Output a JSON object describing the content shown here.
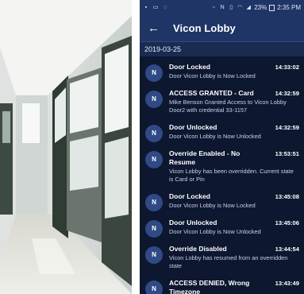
{
  "status_bar": {
    "battery": "23%",
    "time": "2:35 PM"
  },
  "app_bar": {
    "back_icon": "arrow-left-icon",
    "title": "Vicon Lobby"
  },
  "date_header": "2019-03-25",
  "events": [
    {
      "avatar": "N",
      "title": "Door Locked",
      "time": "14:33:02",
      "description": "Door Vicon Lobby is Now Locked"
    },
    {
      "avatar": "N",
      "title": "ACCESS GRANTED - Card",
      "time": "14:32:59",
      "description": "Mike Benson Granted Access to Vicon Lobby Door2 with credential 33-1157"
    },
    {
      "avatar": "N",
      "title": "Door Unlocked",
      "time": "14:32:59",
      "description": "Door Vicon Lobby is Now Unlocked"
    },
    {
      "avatar": "N",
      "title": "Override Enabled - No Resume",
      "time": "13:53:51",
      "description": "Vicon Lobby has been overridden. Current state is Card or Pin"
    },
    {
      "avatar": "N",
      "title": "Door Locked",
      "time": "13:45:08",
      "description": "Door Vicon Lobby is Now Locked"
    },
    {
      "avatar": "N",
      "title": "Door Unlocked",
      "time": "13:45:06",
      "description": "Door Vicon Lobby is Now Unlocked"
    },
    {
      "avatar": "N",
      "title": "Override Disabled",
      "time": "13:44:54",
      "description": "Vicon Lobby has resumed from an overridden state"
    },
    {
      "avatar": "N",
      "title": "ACCESS DENIED, Wrong Timezone",
      "time": "13:43:49",
      "description": ""
    }
  ],
  "colors": {
    "app_bar": "#1f3566",
    "background": "#0d1730",
    "avatar": "#2f4a85"
  }
}
